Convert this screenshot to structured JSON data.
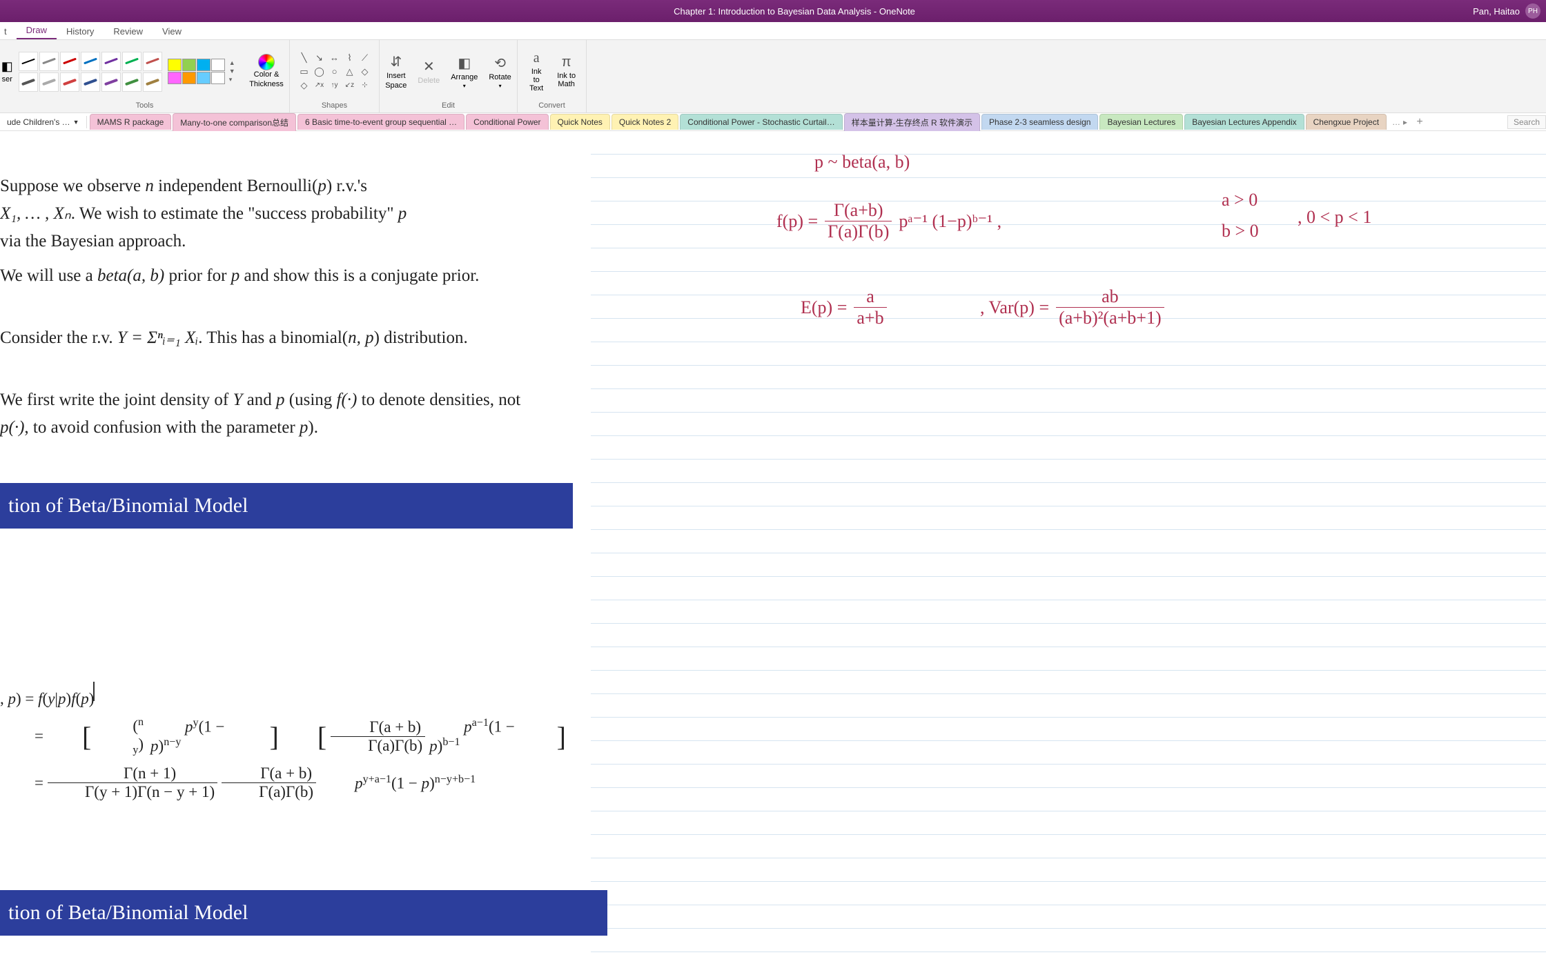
{
  "window": {
    "title": "Chapter 1: Introduction to Bayesian Data Analysis  -  OneNote",
    "user_name": "Pan, Haitao",
    "user_initials": "PH"
  },
  "ribbon_tabs": [
    "t",
    "Draw",
    "History",
    "Review",
    "View"
  ],
  "ribbon_active_tab": "Draw",
  "ribbon_groups": {
    "tools": {
      "label": "Tools",
      "eraser": "ser",
      "color_thickness": "Color & Thickness"
    },
    "shapes": {
      "label": "Shapes"
    },
    "edit": {
      "label": "Edit",
      "buttons": [
        "Insert",
        "Delete",
        "Arrange",
        "Rotate"
      ]
    },
    "convert": {
      "label": "Convert",
      "ink_to_text": "Ink to Text",
      "ink_to_math": "Ink to Math"
    }
  },
  "pen_colors_row1": [
    "#000000",
    "#888888",
    "#c00000",
    "#0070c0",
    "#7030a0",
    "#00b050",
    "#c0504d"
  ],
  "pen_colors_row2": [
    "#555555",
    "#aaaaaa",
    "#d04040",
    "#305090",
    "#8040a0",
    "#409040",
    "#a08040"
  ],
  "swatches": [
    "#ffff00",
    "#92d050",
    "#00b0f0",
    "#ffffff",
    "#ff66ff",
    "#ff9900",
    "#66ccff",
    "#ffffff"
  ],
  "notebook_dropdown": "ude Children's …",
  "section_tabs": [
    {
      "label": "MAMS R package",
      "color": "#f4c2d7"
    },
    {
      "label": "Many-to-one comparison总结",
      "color": "#f4c2d7"
    },
    {
      "label": "6 Basic time-to-event group sequential …",
      "color": "#f4c2d7"
    },
    {
      "label": "Conditional Power",
      "color": "#f4c2d7"
    },
    {
      "label": "Quick Notes",
      "color": "#fff2b3"
    },
    {
      "label": "Quick Notes 2",
      "color": "#fff2b3"
    },
    {
      "label": "Conditional Power - Stochastic Curtail…",
      "color": "#b3e0d6"
    },
    {
      "label": "样本量计算-生存终点 R 软件演示",
      "color": "#d4c2e8"
    },
    {
      "label": "Phase 2-3 seamless design",
      "color": "#c2d8f0"
    },
    {
      "label": "Bayesian Lectures",
      "color": "#c8e8c0"
    },
    {
      "label": "Bayesian Lectures Appendix",
      "color": "#b3e0d6"
    },
    {
      "label": "Chengxue Project",
      "color": "#e8d4c2"
    }
  ],
  "search_placeholder": "Search",
  "slide": {
    "para1_a": "Suppose we observe ",
    "para1_b": " independent Bernoulli(",
    "para1_c": ") r.v.'s ",
    "para1_d": ". We wish to estimate the \"success probability\" ",
    "para1_e": " via the Bayesian approach.",
    "para2_a": "We will use a ",
    "para2_b": " prior for ",
    "para2_c": " and show this is a conjugate prior.",
    "para3_a": "Consider the r.v. ",
    "para3_b": ". This has a binomial(",
    "para3_c": ") distribution.",
    "para4_a": "We first write the joint density of ",
    "para4_b": " and ",
    "para4_c": " (using ",
    "para4_d": " to denote densities, not ",
    "para4_e": ", to avoid confusion with the parameter ",
    "para4_f": ").",
    "header1": "tion of Beta/Binomial Model",
    "header2": "tion of Beta/Binomial Model",
    "math_vars": {
      "n": "n",
      "p": "p",
      "X1Xn": "X₁, … , Xₙ",
      "beta_ab": "beta(a, b)",
      "Y": "Y",
      "sum": "Y = Σⁿᵢ₌₁ Xᵢ",
      "np": "n, p",
      "f_dot": "f(·)",
      "p_dot": "p(·)"
    }
  },
  "equation": {
    "line1": ", p) = f(y|p)f(p)",
    "line2": "= [(ⁿᵧ) pʸ(1 − p)ⁿ⁻ʸ] [Γ(a+b)/(Γ(a)Γ(b)) pᵃ⁻¹(1 − p)ᵇ⁻¹]",
    "line3": "= Γ(n+1)/(Γ(y+1)Γ(n−y+1)) · Γ(a+b)/(Γ(a)Γ(b)) · pʸ⁺ᵃ⁻¹(1 − p)ⁿ⁻ʸ⁺ᵇ⁻¹"
  },
  "ink": {
    "line1": "p ~ beta(a, b)",
    "density_lhs": "f(p) =",
    "density_num": "Γ(a+b)",
    "density_den": "Γ(a)Γ(b)",
    "density_rhs": "pᵃ⁻¹ (1−p)ᵇ⁻¹ ,",
    "constraints_a": "a > 0",
    "constraints_b": "b > 0",
    "constraints_p": ", 0 < p < 1",
    "mean_lhs": "E(p) =",
    "mean_num": "a",
    "mean_den": "a+b",
    "var_lhs": ", Var(p) =",
    "var_num": "ab",
    "var_den": "(a+b)²(a+b+1)"
  }
}
